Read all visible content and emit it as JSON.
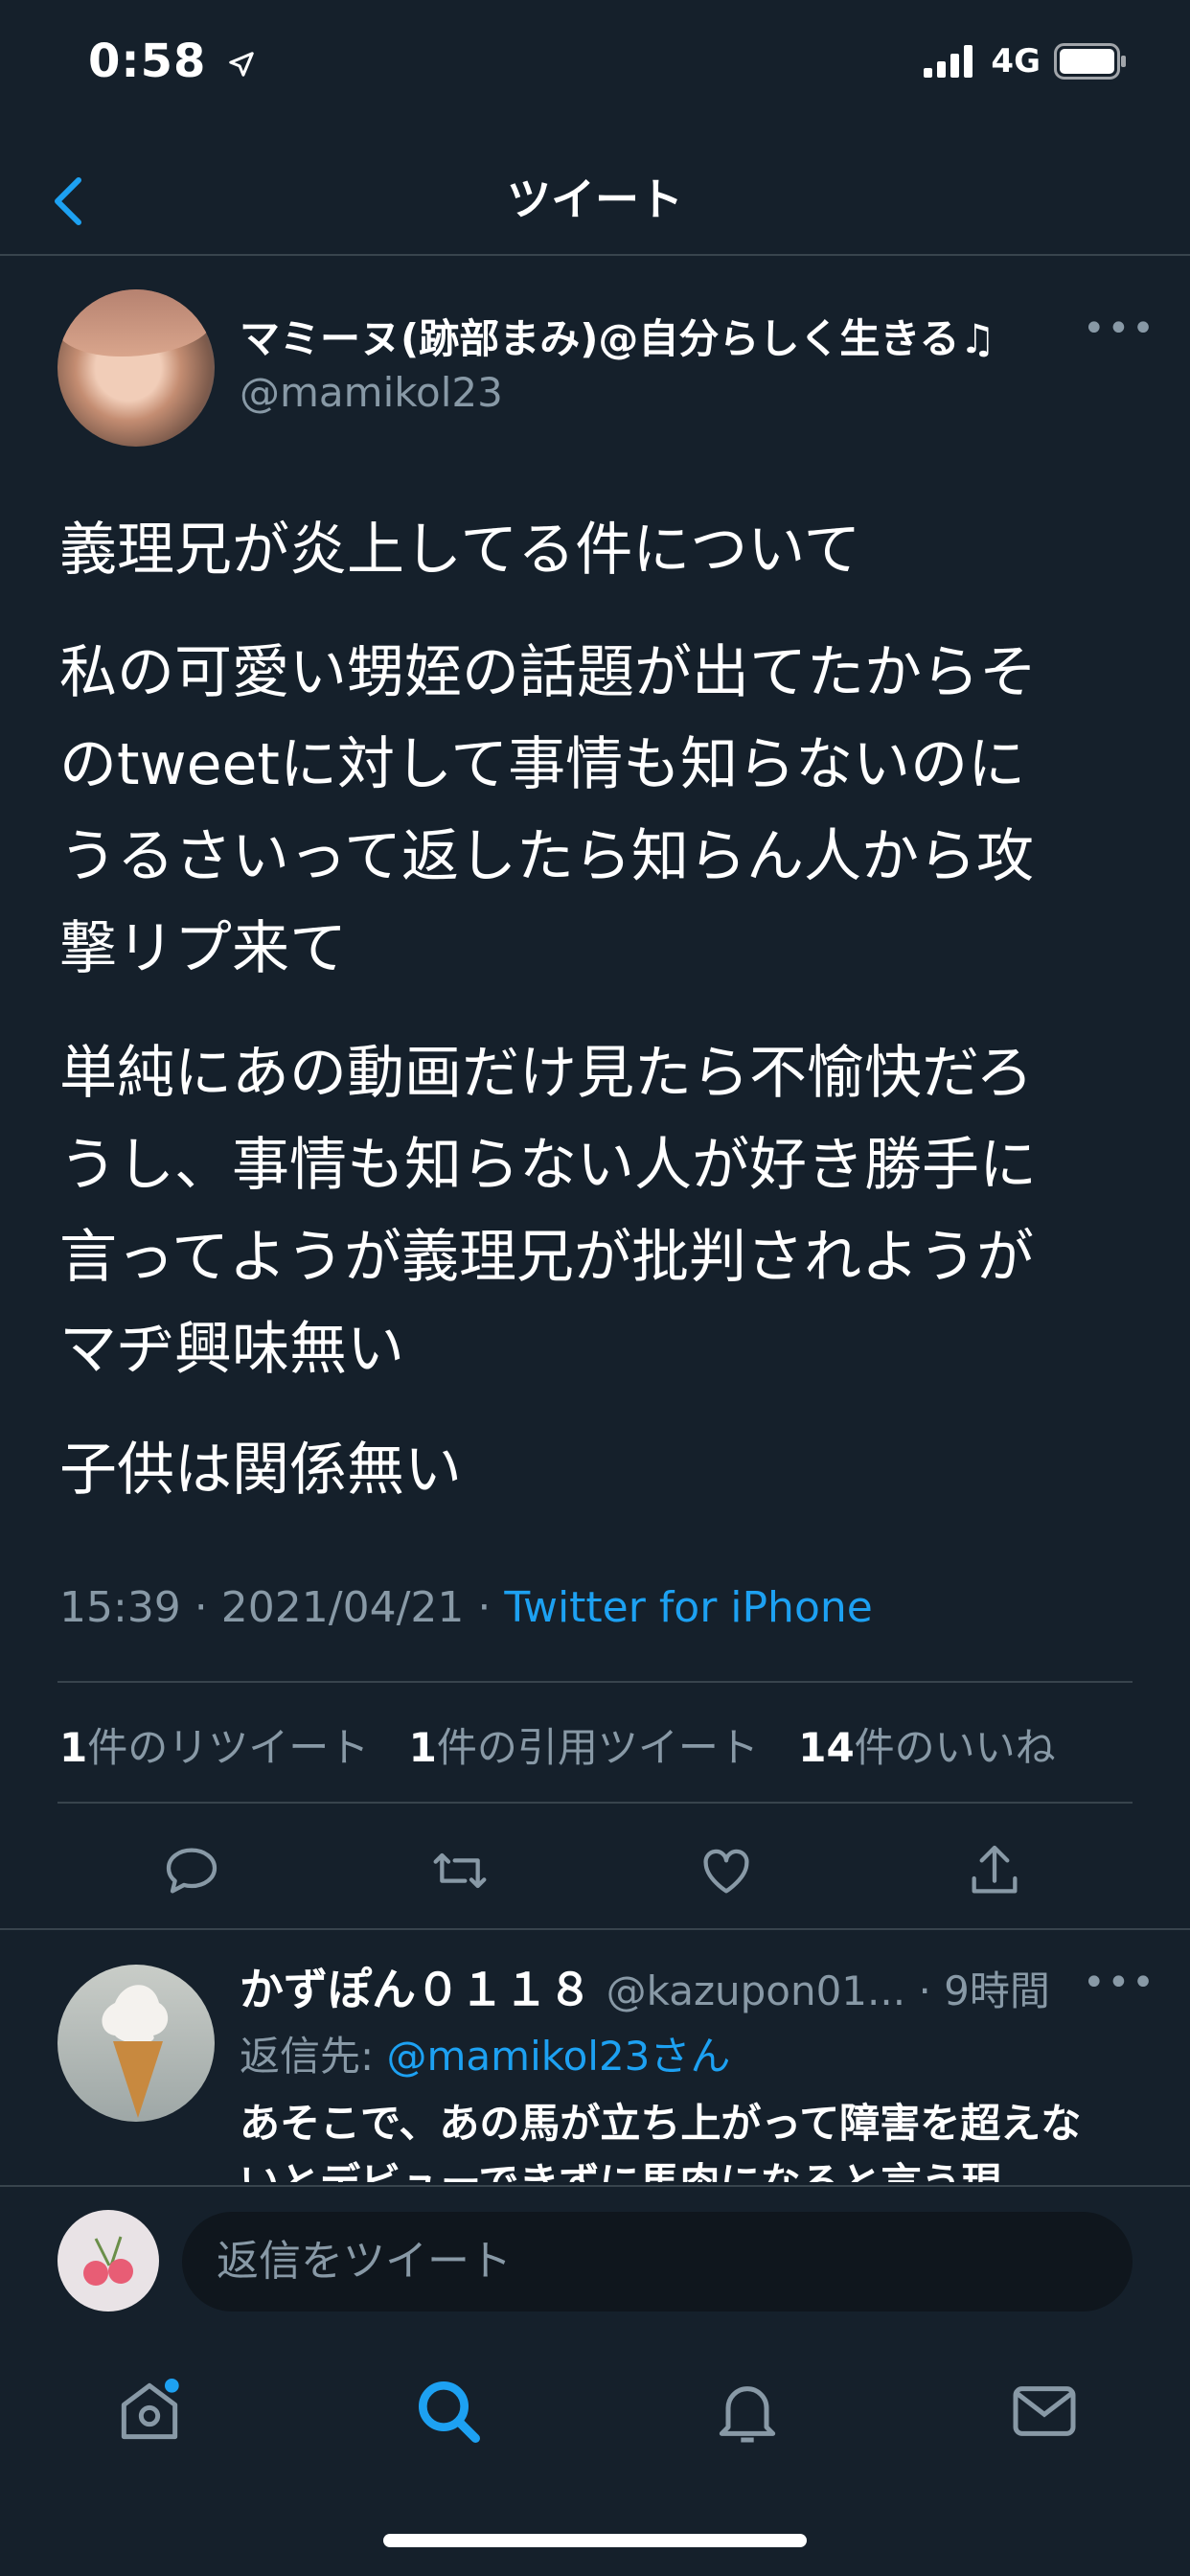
{
  "status_bar": {
    "time": "0:58",
    "network": "4G"
  },
  "header": {
    "title": "ツイート"
  },
  "tweet": {
    "author_name": "マミーヌ(跡部まみ)@自分らしく生きる♫",
    "author_handle": "@mamikol23",
    "paragraphs": [
      "義理兄が炎上してる件について",
      "私の可愛い甥姪の話題が出てたからそ\nのtweetに対して事情も知らないのに\nうるさいって返したら知らん人から攻\n撃リプ来て",
      "単純にあの動画だけ見たら不愉快だろ\nうし、事情も知らない人が好き勝手に\n言ってようが義理兄が批判されようが\nマヂ興味無い",
      "子供は関係無い"
    ],
    "time": "15:39",
    "date": "2021/04/21",
    "source": "Twitter for iPhone",
    "stats": {
      "retweets_count": "1",
      "retweets_label": "件のリツイート",
      "quotes_count": "1",
      "quotes_label": "件の引用ツイート",
      "likes_count": "14",
      "likes_label": "件のいいね"
    }
  },
  "reply": {
    "author_name": "かずぽん０１１８",
    "author_handle": "@kazupon01...",
    "time_ago": "9時間",
    "reply_to_label": "返信先: ",
    "reply_to_handle": "@mamikol23さん",
    "text": "あそこで、あの馬が立ち上がって障害を超えないとデビューできずに馬肉になると言う現"
  },
  "compose": {
    "placeholder": "返信をツイート"
  },
  "colors": {
    "background": "#15202b",
    "accent": "#1da1f2",
    "secondary_text": "#8899a6",
    "divider": "#38444d"
  },
  "icons": [
    "location-arrow-icon",
    "signal-icon",
    "battery-icon",
    "back-chevron-icon",
    "more-icon",
    "reply-icon",
    "retweet-icon",
    "like-icon",
    "share-icon",
    "home-icon",
    "search-icon",
    "notifications-icon",
    "messages-icon"
  ]
}
